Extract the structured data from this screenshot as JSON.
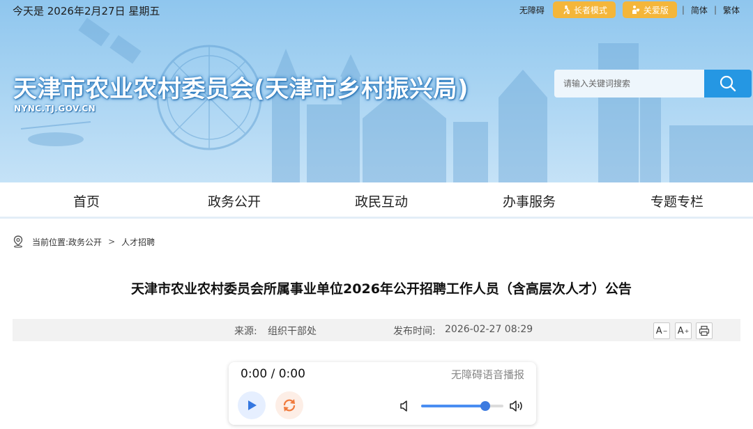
{
  "topbar": {
    "date": "今天是 2026年2月27日 星期五",
    "accessibility": "无障碍",
    "elder_mode": "长者模式",
    "care_version": "关爱版",
    "simplified": "简体",
    "traditional": "繁体",
    "separator": "|"
  },
  "header": {
    "site_title": "天津市农业农村委员会(天津市乡村振兴局)",
    "site_domain": "NYNC.TJ.GOV.CN",
    "search_placeholder": "请输入关键词搜索"
  },
  "nav": {
    "items": [
      "首页",
      "政务公开",
      "政民互动",
      "办事服务",
      "专题专栏"
    ]
  },
  "breadcrumb": {
    "label": "当前位置:",
    "path": [
      "政务公开",
      "人才招聘"
    ],
    "separator": ">"
  },
  "article": {
    "title": "天津市农业农村委员会所属事业单位2026年公开招聘工作人员（含高层次人才）公告",
    "source_label": "来源:",
    "source_value": "组织干部处",
    "date_label": "发布时间:",
    "date_value": "2026-02-27 08:29",
    "font_increase": "A",
    "font_decrease": "A"
  },
  "player": {
    "time": "0:00 / 0:00",
    "label": "无障碍语音播报",
    "volume": 0.78
  },
  "colors": {
    "accent": "#2597e3",
    "button_orange": "#f4b63a",
    "banner_blue": "#a7d3f2"
  }
}
